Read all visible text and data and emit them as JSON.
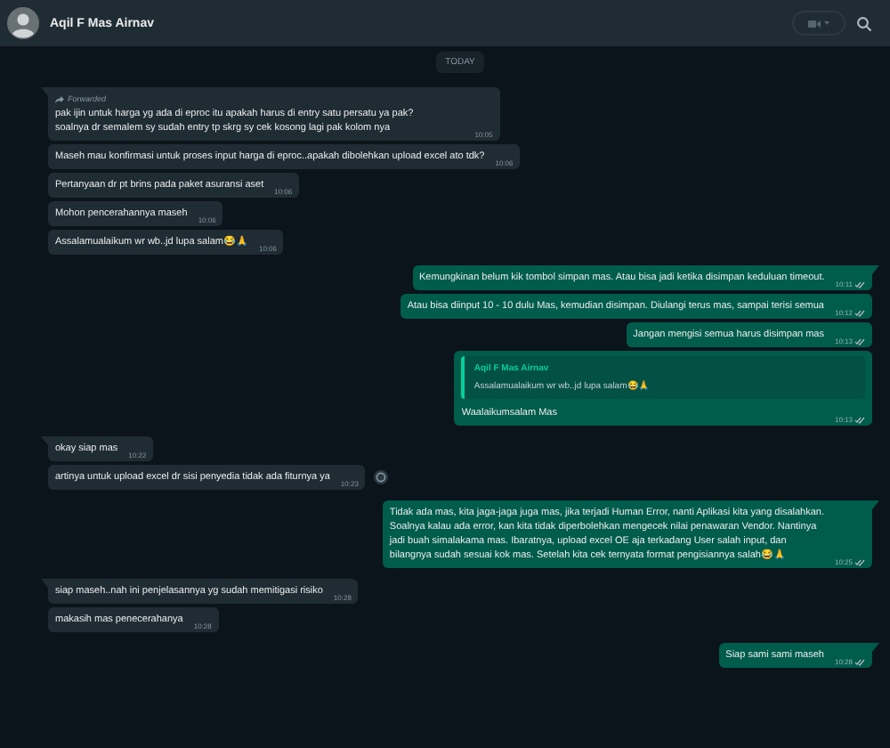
{
  "header": {
    "contact_name": "Aqil F Mas Airnav"
  },
  "messages": [
    {
      "kind": "date",
      "text": "TODAY"
    },
    {
      "kind": "incoming",
      "tail": true,
      "forwarded": "Forwarded",
      "text": "pak ijin untuk harga yg ada di eproc itu apakah harus di entry satu persatu ya pak?\nsoalnya dr semalem sy sudah entry tp skrg sy cek kosong lagi pak kolom nya",
      "time": "10:05"
    },
    {
      "kind": "incoming",
      "tail": false,
      "text": "Maseh mau konfirmasi untuk proses input harga di eproc..apakah dibolehkan upload excel ato tdk?",
      "time": "10:06"
    },
    {
      "kind": "incoming",
      "tail": false,
      "text": "Pertanyaan dr pt brins pada paket asuransi aset",
      "time": "10:06"
    },
    {
      "kind": "incoming",
      "tail": false,
      "text": "Mohon pencerahannya maseh",
      "time": "10:06"
    },
    {
      "kind": "incoming",
      "tail": false,
      "text": "Assalamualaikum wr wb..jd lupa salam😂🙏",
      "time": "10:06"
    },
    {
      "kind": "outgoing",
      "tail": true,
      "text": "Kemungkinan belum kik tombol simpan mas. Atau bisa jadi ketika disimpan keduluan timeout.",
      "time": "10:11"
    },
    {
      "kind": "outgoing",
      "tail": false,
      "text": "Atau bisa diinput 10 - 10 dulu Mas, kemudian disimpan. Diulangi terus mas, sampai terisi semua",
      "time": "10:12"
    },
    {
      "kind": "outgoing",
      "tail": false,
      "text": "Jangan mengisi semua harus disimpan mas",
      "time": "10:13"
    },
    {
      "kind": "outgoing",
      "tail": false,
      "quote": {
        "author": "Aqil F Mas Airnav",
        "text": "Assalamualaikum wr wb..jd lupa salam😂🙏"
      },
      "text": "Waalaikumsalam Mas",
      "time": "10:13"
    },
    {
      "kind": "incoming",
      "tail": true,
      "text": "okay siap mas",
      "time": "10:22"
    },
    {
      "kind": "incoming",
      "tail": false,
      "reaction_button": true,
      "text": "artinya untuk upload excel dr sisi penyedia tidak ada fiturnya ya",
      "time": "10:23"
    },
    {
      "kind": "outgoing",
      "tail": true,
      "text": "Tidak ada mas, kita jaga-jaga juga mas, jika terjadi Human Error, nanti Aplikasi kita yang disalahkan.\nSoalnya kalau ada error, kan kita tidak diperbolehkan mengecek nilai penawaran Vendor. Nantinya\njadi buah simalakama mas. Ibaratnya, upload excel OE aja terkadang User salah input, dan\nbilangnya sudah sesuai kok mas. Setelah kita cek ternyata format pengisiannya salah😂🙏",
      "time": "10:25"
    },
    {
      "kind": "incoming",
      "tail": true,
      "text": "siap maseh..nah ini penjelasannya yg sudah memitigasi risiko",
      "time": "10:28"
    },
    {
      "kind": "incoming",
      "tail": false,
      "text": "makasih mas penecerahanya",
      "time": "10:28"
    },
    {
      "kind": "outgoing",
      "tail": true,
      "text": "Siap sami sami maseh",
      "time": "10:28"
    }
  ]
}
